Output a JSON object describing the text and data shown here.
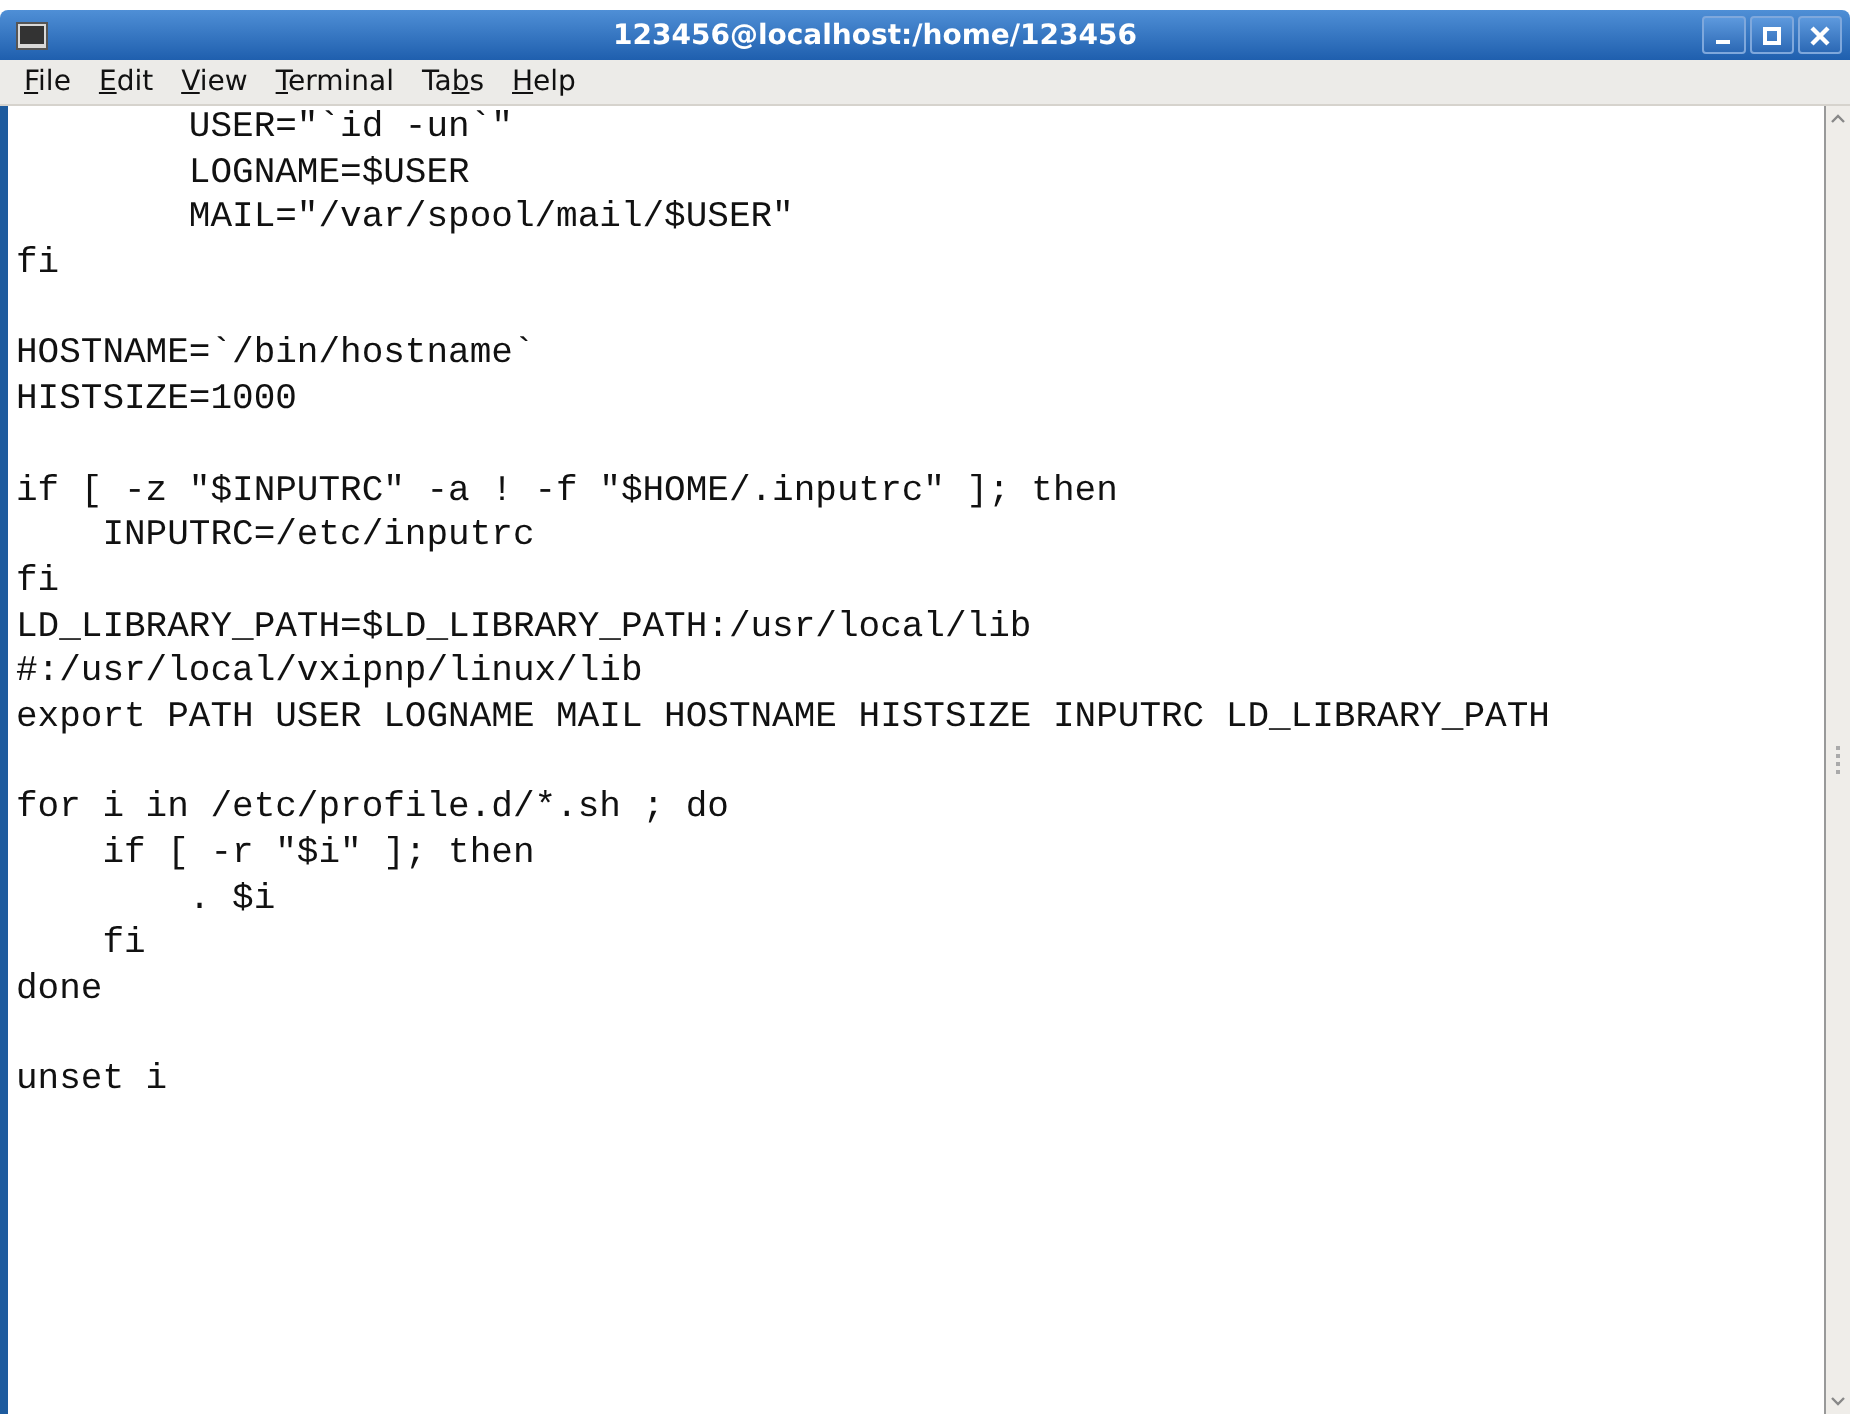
{
  "window": {
    "title": "123456@localhost:/home/123456"
  },
  "menu": [
    {
      "key": "F",
      "after": "ile"
    },
    {
      "key": "E",
      "after": "dit"
    },
    {
      "key": "V",
      "after": "iew"
    },
    {
      "key": "T",
      "after": "erminal"
    },
    {
      "before": "Ta",
      "key": "b",
      "after": "s"
    },
    {
      "key": "H",
      "after": "elp"
    }
  ],
  "terminal": {
    "blocks": [
      {
        "lines": [
          "        USER=\"`id -un`\"",
          "        LOGNAME=$USER",
          "        MAIL=\"/var/spool/mail/$USER\"",
          "fi"
        ]
      },
      {
        "lines": [
          "HOSTNAME=`/bin/hostname`",
          "HISTSIZE=1000"
        ]
      },
      {
        "lines": [
          "if [ -z \"$INPUTRC\" -a ! -f \"$HOME/.inputrc\" ]; then",
          "    INPUTRC=/etc/inputrc",
          "fi",
          "LD_LIBRARY_PATH=$LD_LIBRARY_PATH:/usr/local/lib",
          "#:/usr/local/vxipnp/linux/lib",
          "export PATH USER LOGNAME MAIL HOSTNAME HISTSIZE INPUTRC LD_LIBRARY_PATH"
        ]
      },
      {
        "lines": [
          "for i in /etc/profile.d/*.sh ; do",
          "    if [ -r \"$i\" ]; then",
          "        . $i",
          "    fi",
          "done"
        ]
      },
      {
        "lines": [
          "unset i"
        ]
      }
    ]
  }
}
